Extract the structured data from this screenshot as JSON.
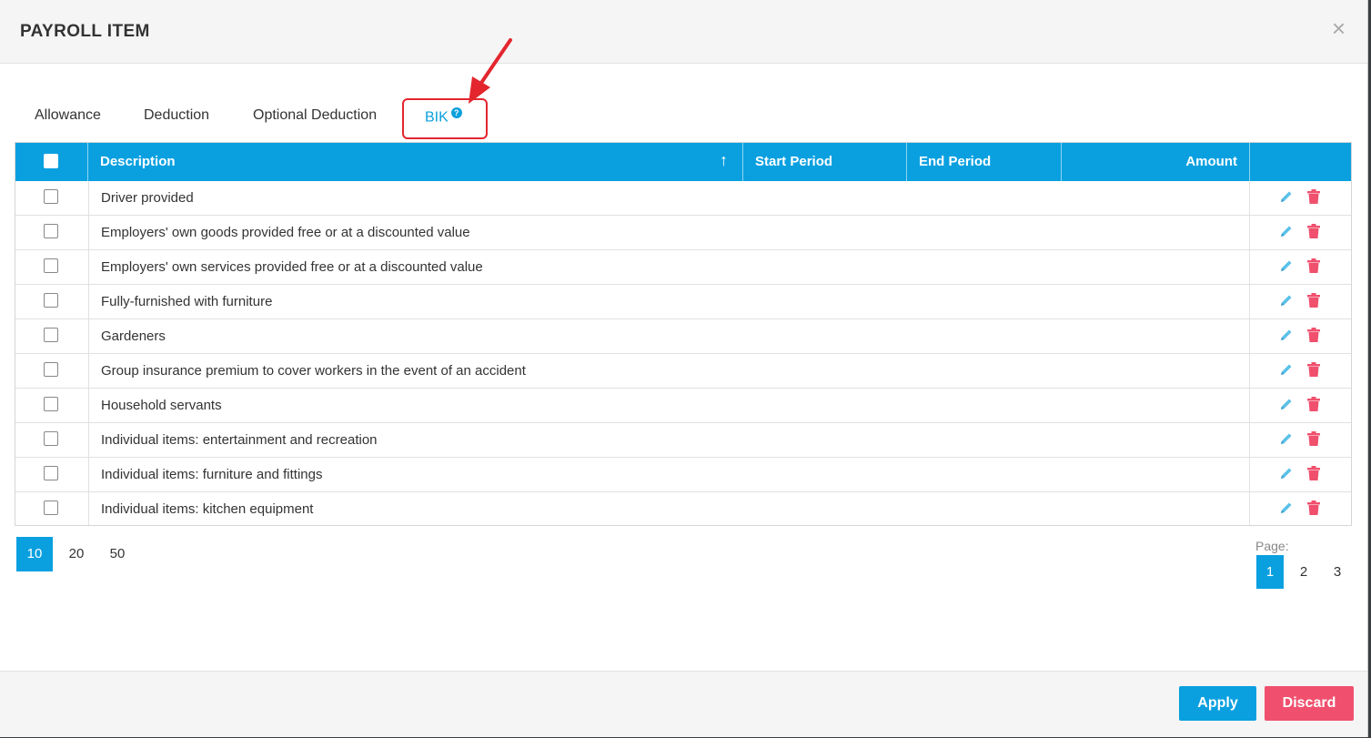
{
  "dialog": {
    "title": "PAYROLL ITEM",
    "close_symbol": "×"
  },
  "tabs": [
    {
      "label": "Allowance"
    },
    {
      "label": "Deduction"
    },
    {
      "label": "Optional Deduction"
    },
    {
      "label": "BIK",
      "active": true,
      "help_icon": "?"
    }
  ],
  "table": {
    "columns": [
      "Description",
      "Start Period",
      "End Period",
      "Amount"
    ],
    "sort_indicator": "↑",
    "rows": [
      {
        "description": "Driver provided"
      },
      {
        "description": "Employers' own goods provided free or at a discounted value"
      },
      {
        "description": "Employers' own services provided free or at a discounted value"
      },
      {
        "description": "Fully-furnished with furniture"
      },
      {
        "description": "Gardeners"
      },
      {
        "description": "Group insurance premium to cover workers in the event of an accident"
      },
      {
        "description": "Household servants"
      },
      {
        "description": "Individual items: entertainment and recreation"
      },
      {
        "description": "Individual items: furniture and fittings"
      },
      {
        "description": "Individual items: kitchen equipment"
      }
    ],
    "row_icons": [
      "pencil-icon",
      "trash-icon"
    ]
  },
  "pagination": {
    "page_sizes": [
      "10",
      "20",
      "50"
    ],
    "selected_page_size": "10",
    "page_label": "Page:",
    "pages": [
      "1",
      "2",
      "3"
    ],
    "current_page": "1"
  },
  "footer": {
    "apply_label": "Apply",
    "discard_label": "Discard"
  },
  "colors": {
    "accent": "#0aa0e0",
    "danger": "#f0506e",
    "annotation": "#e3262e"
  }
}
